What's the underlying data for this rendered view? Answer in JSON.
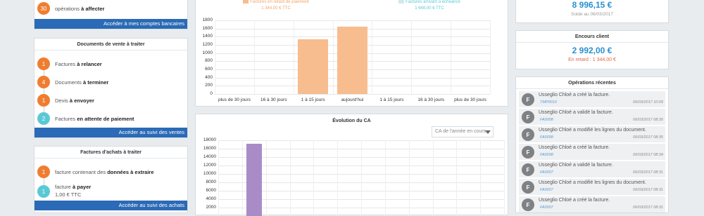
{
  "bank": {
    "count": "30",
    "prefix": "opérations ",
    "bold": "à affecter",
    "link": "Accéder à mes comptes bancaires"
  },
  "sales": {
    "title": "Documents de vente à traiter",
    "items": [
      {
        "count": "1",
        "prefix": "Factures ",
        "bold": "à relancer",
        "color": "#ef7d31"
      },
      {
        "count": "4",
        "prefix": "Documents ",
        "bold": "à terminer",
        "color": "#ef7d31"
      },
      {
        "count": "1",
        "prefix": "Devis ",
        "bold": "à envoyer",
        "color": "#ef7d31"
      },
      {
        "count": "2",
        "prefix": "Factures ",
        "bold": "en attente de paiement",
        "color": "#5bc8d6"
      }
    ],
    "link": "Accéder au suivi des ventes"
  },
  "purchases": {
    "title": "Factures d'achats à traiter",
    "items": [
      {
        "count": "1",
        "prefix": "facture contenant des ",
        "bold": "données à extraire",
        "color": "#ef7d31"
      },
      {
        "count": "1",
        "prefix": "facture ",
        "bold": "à payer",
        "sub": "1,00 € TTC",
        "color": "#5bc8d6"
      }
    ],
    "link": "Accéder au suivi des achats"
  },
  "aging_chart": {
    "legend_late": {
      "label": "Factures en retard de paiement",
      "amount": "1 344,00 € TTC"
    },
    "legend_due": {
      "label": "Factures arrivant à échéance",
      "amount": "1 648,00 € TTC"
    },
    "chart_data": {
      "type": "bar",
      "categories": [
        "plus de 30 jours",
        "16 à 30 jours",
        "1 à 15 jours",
        "aujourd'hui",
        "1 à 15 jours",
        "16 à 30 jours",
        "plus de 30 jours"
      ],
      "series": [
        {
          "name": "Factures en retard de paiement",
          "values": [
            0,
            0,
            1344,
            0,
            0,
            0,
            0
          ],
          "color": "#f7bd8e"
        },
        {
          "name": "Factures arrivant à échéance",
          "values": [
            0,
            0,
            0,
            1648,
            0,
            0,
            0
          ],
          "color": "#f7bd8e"
        }
      ],
      "yticks": [
        "1800",
        "1600",
        "1400",
        "1200",
        "1000",
        "800",
        "600",
        "400",
        "200",
        "0"
      ],
      "ylim": [
        0,
        1800
      ]
    }
  },
  "ca_chart": {
    "title": "Évolution du CA",
    "select_value": "CA de l'année en cours",
    "chart_data": {
      "type": "bar",
      "values": [
        17200
      ],
      "color": "#a98cc7",
      "yticks": [
        "18000",
        "16000",
        "14000",
        "12000",
        "10000",
        "8000",
        "6000",
        "4000",
        "2000"
      ],
      "ylim": [
        0,
        18000
      ]
    }
  },
  "balance": {
    "amount": "8 996,15 €",
    "caption": "Solde au 06/03/2017"
  },
  "encours": {
    "title": "Encours client",
    "amount": "2 992,00 €",
    "late": "En retard : 1 344,00 €"
  },
  "operations": {
    "title": "Opérations récentes",
    "items": [
      {
        "avatar": "F",
        "text": "Usseglio Chloé a créé la facture.",
        "code": "TMP0010",
        "date": "06/03/2017 10:09"
      },
      {
        "avatar": "F",
        "text": "Usseglio Chloé a validé la facture.",
        "code": "FA0008",
        "date": "06/03/2017 08:35"
      },
      {
        "avatar": "F",
        "text": "Usseglio Chloé a modifié les lignes du document.",
        "code": "FA0008",
        "date": "06/03/2017 08:35"
      },
      {
        "avatar": "F",
        "text": "Usseglio Chloé a créé la facture.",
        "code": "FA0008",
        "date": "06/03/2017 08:34"
      },
      {
        "avatar": "F",
        "text": "Usseglio Chloé a validé la facture.",
        "code": "FA0007",
        "date": "06/03/2017 08:31"
      },
      {
        "avatar": "F",
        "text": "Usseglio Chloé a modifié les lignes du document.",
        "code": "FA0007",
        "date": "06/03/2017 08:31"
      },
      {
        "avatar": "F",
        "text": "Usseglio Chloé a créé la facture.",
        "code": "FA0007",
        "date": "06/03/2017 08:31"
      }
    ]
  }
}
